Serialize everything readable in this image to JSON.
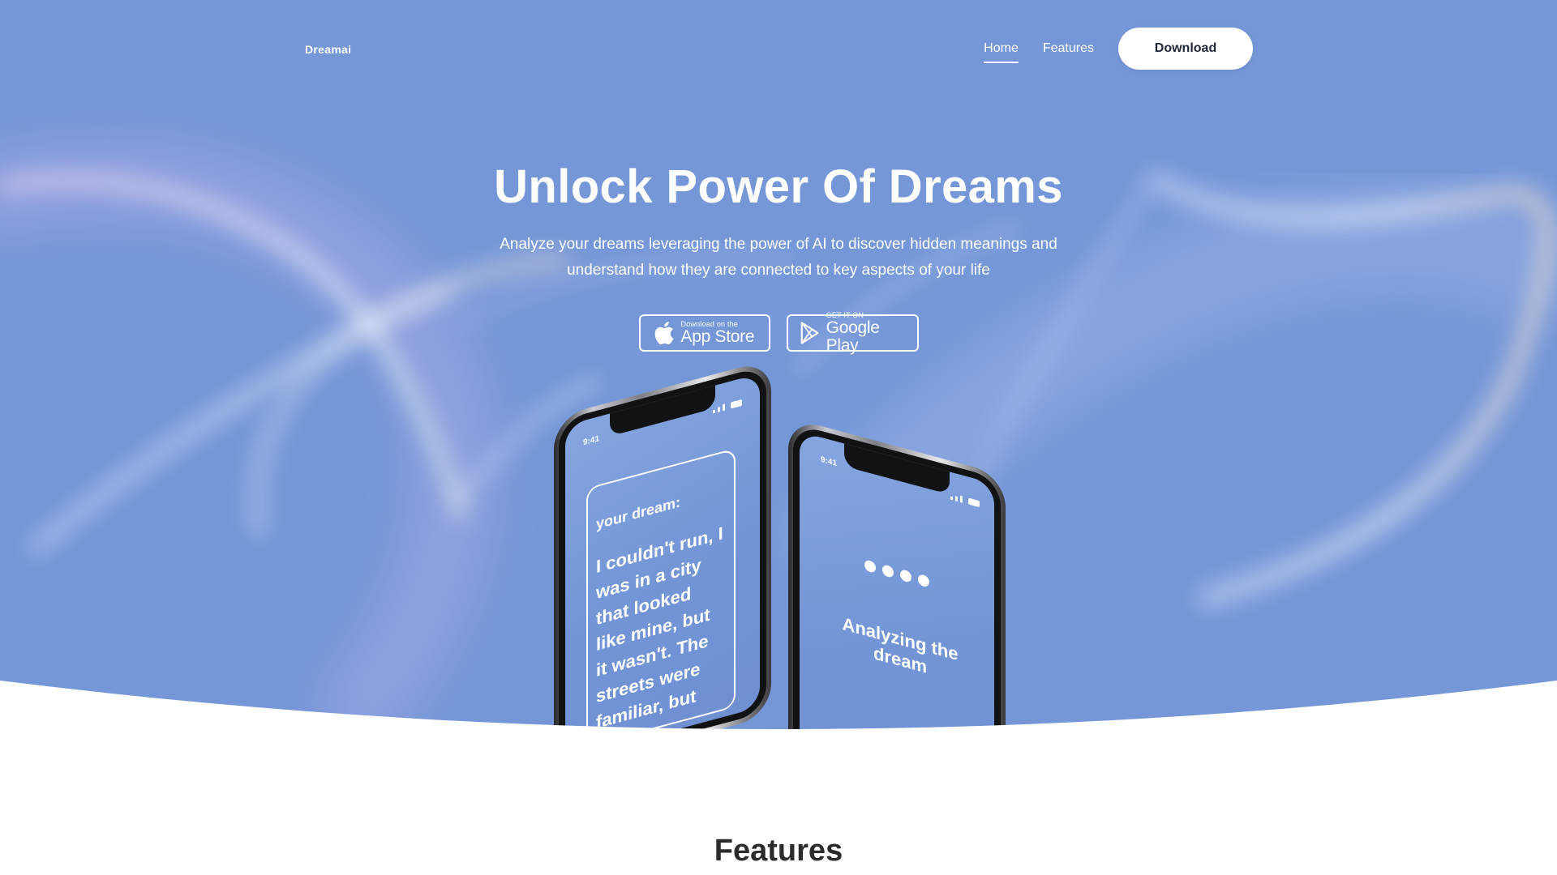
{
  "brand": {
    "name": "Dreamai"
  },
  "nav": {
    "links": [
      {
        "label": "Home",
        "active": true
      },
      {
        "label": "Features",
        "active": false
      }
    ],
    "cta_label": "Download"
  },
  "hero": {
    "title": "Unlock Power Of Dreams",
    "subtitle_line1": "Analyze your dreams leveraging the power of AI to discover hidden meanings and",
    "subtitle_line2": "understand how they are connected to key aspects of your life",
    "background_color": "#7597d8"
  },
  "store_badges": {
    "apple": {
      "small": "Download on the",
      "big": "App Store",
      "icon": "apple-icon"
    },
    "google": {
      "small": "GET IT ON",
      "big": "Google Play",
      "icon": "google-play-icon"
    }
  },
  "phone_left": {
    "time": "9:41",
    "card_label": "your dream:",
    "card_text": "I couldn't run, I was in a city that looked like mine, but it wasn't. The streets were familiar, but the"
  },
  "phone_right": {
    "time": "9:41",
    "status_text": "Analyzing the dream"
  },
  "features": {
    "heading": "Features"
  }
}
